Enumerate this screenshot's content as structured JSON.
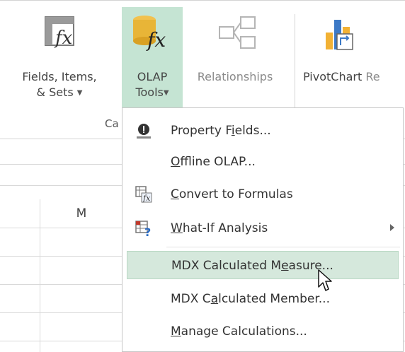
{
  "ribbon": {
    "fields_items_sets": {
      "line1": "Fields, Items,",
      "line2": "& Sets",
      "icon": "fx-table-icon"
    },
    "olap_tools": {
      "line1": "OLAP",
      "line2": "Tools",
      "icon": "olap-cube-fx-icon"
    },
    "relationships": {
      "label": "Relationships",
      "icon": "relationships-icon"
    },
    "pivotchart": {
      "label": "PivotChart",
      "trailing": "Re",
      "icon": "pivotchart-icon"
    },
    "group_label": "Ca"
  },
  "sheet": {
    "column_header": "M"
  },
  "menu": {
    "items": [
      {
        "pre": "Property F",
        "ul": "i",
        "post": "elds...",
        "icon": "property-fields-icon"
      },
      {
        "pre": "",
        "ul": "O",
        "post": "ffline OLAP...",
        "icon": ""
      },
      {
        "pre": "",
        "ul": "C",
        "post": "onvert to Formulas",
        "icon": "convert-formulas-icon"
      },
      {
        "pre": "",
        "ul": "W",
        "post": "hat-If Analysis",
        "icon": "what-if-icon",
        "submenu": true
      },
      {
        "pre": "MDX Calculated M",
        "ul": "e",
        "post": "asure...",
        "icon": "",
        "highlighted": true
      },
      {
        "pre": "MDX C",
        "ul": "a",
        "post": "lculated Member...",
        "icon": ""
      },
      {
        "pre": "",
        "ul": "M",
        "post": "anage Calculations...",
        "icon": ""
      }
    ]
  },
  "colors": {
    "olap_highlight": "#c5e4d3",
    "menu_hover": "#d5e8dc",
    "accent_gold": "#e8b537"
  }
}
